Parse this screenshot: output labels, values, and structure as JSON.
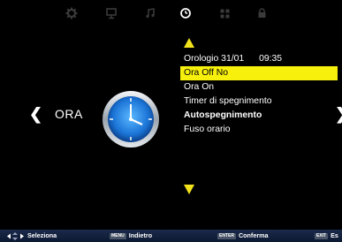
{
  "top_icons": [
    {
      "name": "gear-icon",
      "active": false
    },
    {
      "name": "monitor-icon",
      "active": false
    },
    {
      "name": "music-note-icon",
      "active": false
    },
    {
      "name": "clock-icon",
      "active": true
    },
    {
      "name": "grid-icon",
      "active": false
    },
    {
      "name": "lock-icon",
      "active": false
    }
  ],
  "side": {
    "left_arrow": "❮",
    "right_arrow": "❯",
    "title": "ORA"
  },
  "menu": {
    "clock_label": "Orologio 31/01",
    "clock_time": "09:35",
    "items": [
      {
        "label": "Ora Off No",
        "selected": true
      },
      {
        "label": "Ora On",
        "selected": false
      },
      {
        "label": "Timer di spegnimento",
        "selected": false
      },
      {
        "label": "Autospegnimento",
        "selected": false
      },
      {
        "label": "Fuso orario",
        "selected": false
      }
    ]
  },
  "bottom_bar": {
    "select_label": "Seleziona",
    "menu_key": "MENU",
    "back_label": "Indietro",
    "enter_key": "ENTER",
    "confirm_label": "Conferma",
    "exit_key": "EXIT",
    "exit_label": "Es"
  },
  "colors": {
    "highlight": "#f7f00c",
    "arrow_yellow": "#f2e21c",
    "icon_inactive": "#3a3a3a",
    "icon_active": "#ffffff",
    "bottom_bar": "#14223f"
  }
}
